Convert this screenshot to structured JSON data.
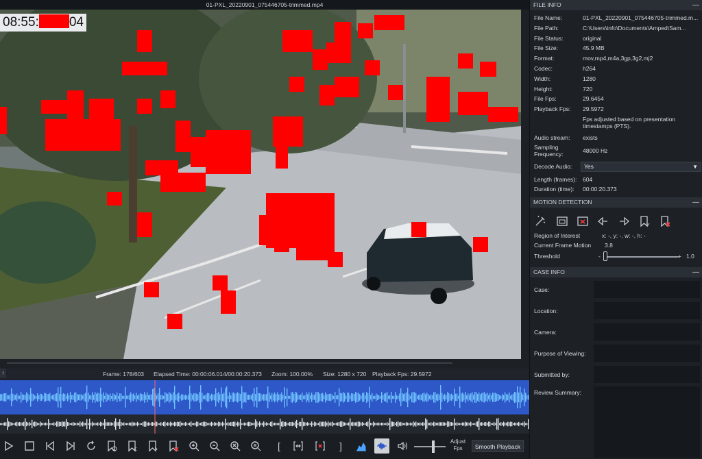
{
  "video": {
    "title": "01-PXL_20220901_075446705-trimmed.mp4",
    "timestamp_prefix": "08:55:",
    "timestamp_suffix": "04"
  },
  "status": {
    "frame": "Frame: 178/603",
    "elapsed": "Elapsed Time: 00:00:06.014/00:00:20.373",
    "zoom": "Zoom: 100.00%",
    "size": "Size: 1280 x 720",
    "playback_fps": "Playback Fps: 29.5972"
  },
  "toolbar": {
    "adjust_fps": "Adjust Fps",
    "smooth_playback": "Smooth Playback",
    "bracket_open": "[",
    "bracket_close": "]",
    "scrub_left": "↑"
  },
  "file_info": {
    "header": "FILE INFO",
    "rows": [
      {
        "label": "File Name:",
        "value": "01-PXL_20220901_075446705-trimmed.m..."
      },
      {
        "label": "File Path:",
        "value": "C:\\Users\\info\\Documents\\Amped\\Sam..."
      },
      {
        "label": "File Status:",
        "value": "original"
      },
      {
        "label": "File Size:",
        "value": "45.9 MB"
      },
      {
        "label": "Format:",
        "value": "mov,mp4,m4a,3gp,3g2,mj2"
      },
      {
        "label": "Codec:",
        "value": "h264"
      },
      {
        "label": "Width:",
        "value": "1280"
      },
      {
        "label": "Height:",
        "value": "720"
      },
      {
        "label": "File Fps:",
        "value": "29.6454"
      },
      {
        "label": "Playback Fps:",
        "value": "29.5972"
      }
    ],
    "fps_note": "Fps adjusted based on presentation timestamps (PTS).",
    "audio_stream_label": "Audio stream:",
    "audio_stream_value": "exists",
    "sampling_label_1": "Sampling",
    "sampling_label_2": "Frequency:",
    "sampling_value": "48000 Hz",
    "decode_audio_label": "Decode Audio:",
    "decode_audio_value": "Yes",
    "length_label": "Length (frames):",
    "length_value": "604",
    "duration_label": "Duration (time):",
    "duration_value": "00:00:20.373"
  },
  "motion": {
    "header": "MOTION DETECTION",
    "roi_label": "Region of Interest",
    "roi_value": "x: -,  y: -,  w: -,  h: -",
    "cfm_label": "Current Frame Motion",
    "cfm_value": "3.8",
    "threshold_label": "Threshold",
    "threshold_minus": "-",
    "threshold_plus": "+",
    "threshold_value": "1.0",
    "threshold_level": 0.02
  },
  "case_info": {
    "header": "CASE INFO",
    "case_label": "Case:",
    "location_label": "Location:",
    "camera_label": "Camera:",
    "purpose_label": "Purpose of Viewing:",
    "submitted_label": "Submitted by:",
    "review_label": "Review Summary:"
  },
  "collapse_glyph": "—"
}
